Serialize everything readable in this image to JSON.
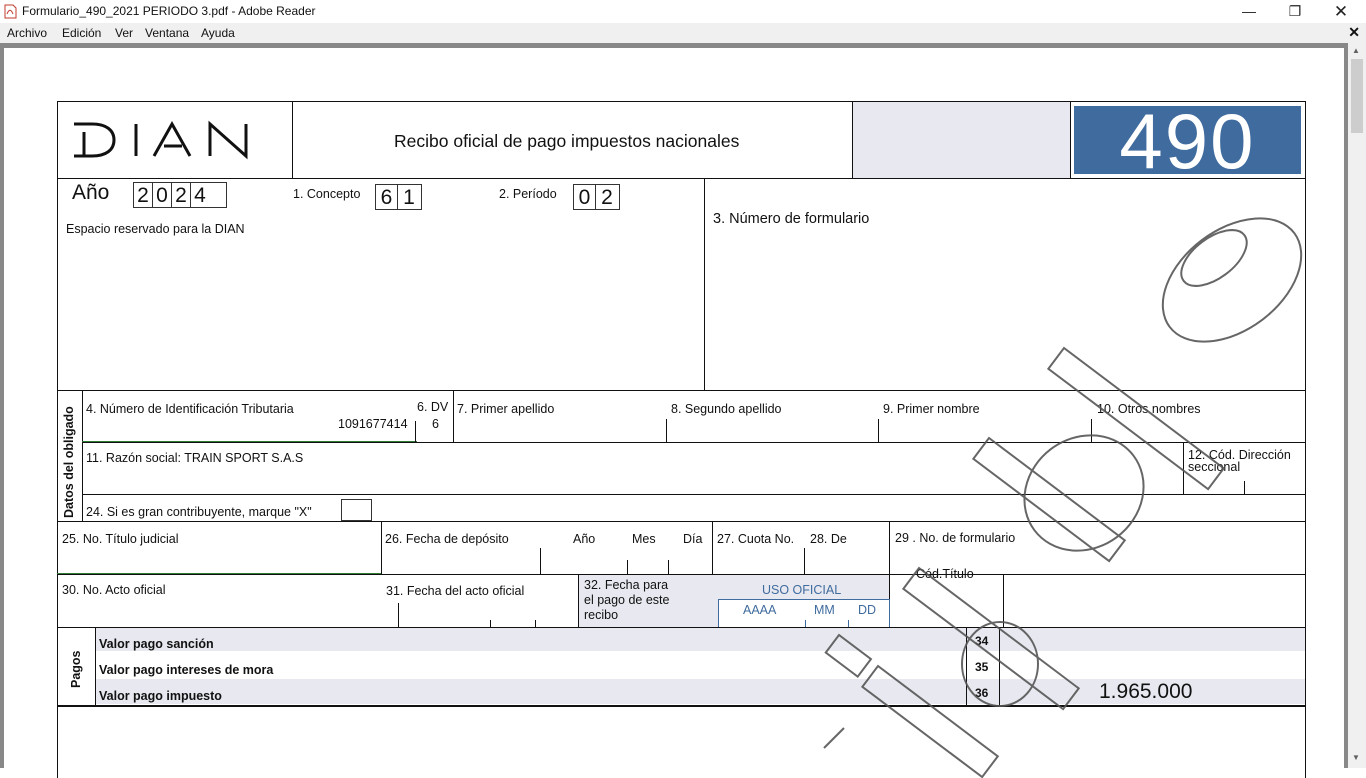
{
  "window": {
    "title": "Formulario_490_2021 PERIODO 3.pdf - Adobe Reader",
    "minimize_icon": "minimize-icon",
    "maximize_icon": "restore-icon",
    "close_icon": "close-icon"
  },
  "menu": [
    "Archivo",
    "Edición",
    "Ver",
    "Ventana",
    "Ayuda"
  ],
  "form": {
    "logo": "DIAN",
    "header_title": "Recibo oficial de pago impuestos nacionales",
    "form_number": "490",
    "anio_label": "Año",
    "anio_digits": [
      "2",
      "0",
      "2",
      "4"
    ],
    "concepto_label": "1. Concepto",
    "concepto_digits": [
      "6",
      "1"
    ],
    "periodo_label": "2. Período",
    "periodo_digits": [
      "0",
      "2"
    ],
    "espacio_label": "Espacio reservado para la DIAN",
    "numero_formulario_label": "3. Número de formulario",
    "datos_obligado": "Datos del obligado",
    "nit_label": "4.  Número de Identificación Tributaria",
    "nit_value": "1091677414",
    "dv_label": "6. DV",
    "dv_value": "6",
    "primer_apellido_label": "7. Primer apellido",
    "segundo_apellido_label": "8. Segundo apellido",
    "primer_nombre_label": "9. Primer nombre",
    "otros_nombres_label": "10. Otros nombres",
    "razon_social_label": "11. Razón social: TRAIN SPORT S.A.S",
    "cod_direccion_label_1": "12. Cód. Dirección",
    "cod_direccion_label_2": "seccional",
    "gran_contribuyente_label": "24. Si es gran contribuyente, marque \"X\"",
    "titulo_judicial_label": "25. No. Título judicial",
    "fecha_deposito_label": "26. Fecha de depósito",
    "anio_col": "Año",
    "mes_col": "Mes",
    "dia_col": "Día",
    "cuota_label": "27. Cuota No.",
    "de_label": "28. De",
    "no_formulario_label": "29 . No. de formulario",
    "acto_oficial_label": "30. No. Acto oficial",
    "fecha_acto_label": "31. Fecha del acto oficial",
    "fecha_pago_label_1": "32. Fecha  para",
    "fecha_pago_label_2": "el pago de este",
    "fecha_pago_label_3": "recibo",
    "uso_oficial": "USO OFICIAL",
    "aaaa": "AAAA",
    "mm": "MM",
    "dd": "DD",
    "cod_titulo": "Cód.Título",
    "pagos_label": "Pagos",
    "pagos": [
      {
        "label": "Valor pago sanción",
        "num": "34",
        "value": ""
      },
      {
        "label": "Valor pago intereses de mora",
        "num": "35",
        "value": ""
      },
      {
        "label": "Valor pago impuesto",
        "num": "36",
        "value": "1.965.000"
      }
    ]
  },
  "colors": {
    "form_blue": "#3f6b9e",
    "shade": "#e8e9f0",
    "green_line": "#2e7d32"
  }
}
